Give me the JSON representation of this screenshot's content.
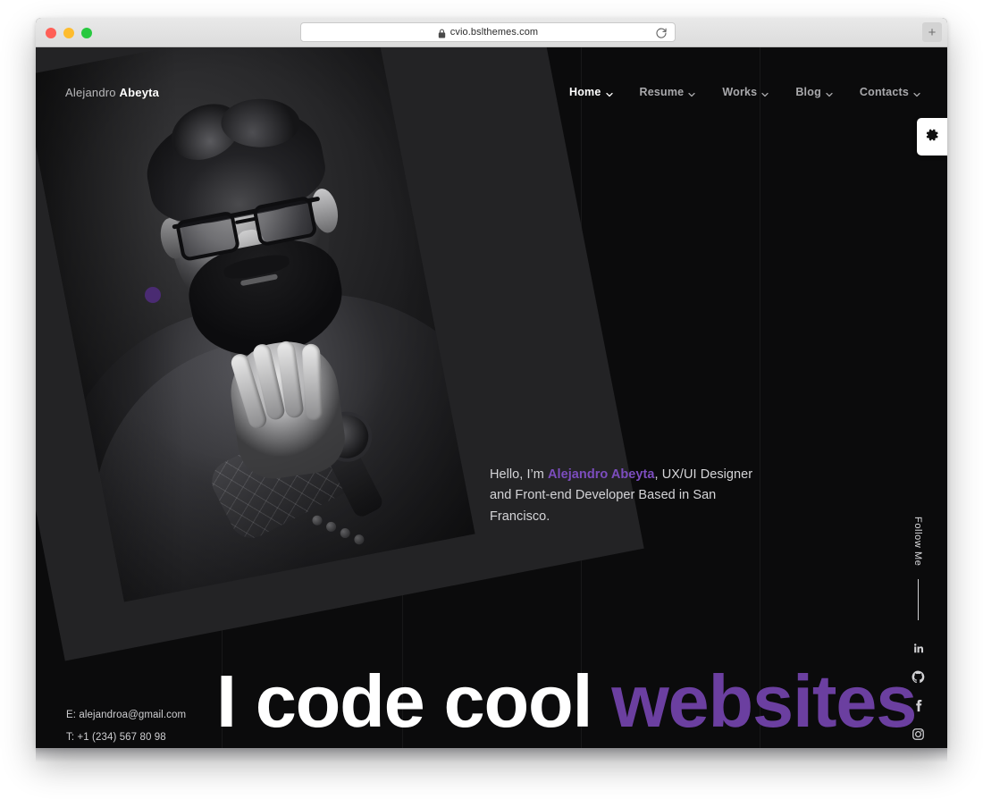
{
  "browser": {
    "url": "cvio.bslthemes.com",
    "lock_icon": "lock-icon",
    "reload_icon": "reload-icon",
    "new_tab_label": "+",
    "traffic_lights": [
      "close",
      "minimize",
      "maximize"
    ]
  },
  "header": {
    "logo_first": "Alejandro",
    "logo_last": "Abeyta",
    "nav": [
      {
        "label": "Home",
        "active": true,
        "caret": "chevron-down-icon"
      },
      {
        "label": "Resume",
        "active": false,
        "caret": "chevron-down-icon"
      },
      {
        "label": "Works",
        "active": false,
        "caret": "chevron-down-icon"
      },
      {
        "label": "Blog",
        "active": false,
        "caret": "chevron-down-icon"
      },
      {
        "label": "Contacts",
        "active": false,
        "caret": "chevron-down-icon"
      }
    ],
    "settings_icon": "gear-icon"
  },
  "hero": {
    "intro_prefix": "Hello, I’m ",
    "intro_name": "Alejandro Abeyta",
    "intro_suffix": ", UX/UI Designer and Front-end Developer Based in San Francisco.",
    "headline_plain": "I code cool ",
    "headline_accent": "websites",
    "portrait_alt": "portrait-photo"
  },
  "contact": {
    "email_line": "E: alejandroa@gmail.com",
    "phone_line": "T: +1 (234) 567 80 98"
  },
  "follow": {
    "label": "Follow Me",
    "socials": [
      {
        "name": "linkedin-icon"
      },
      {
        "name": "github-icon"
      },
      {
        "name": "facebook-icon"
      },
      {
        "name": "instagram-icon"
      }
    ]
  },
  "colors": {
    "accent_purple": "#7c4dbe",
    "headline_purple": "#6b3fa0",
    "page_background": "#0b0b0c",
    "panel_gray": "#232325",
    "dot_purple": "#4a2b72"
  }
}
